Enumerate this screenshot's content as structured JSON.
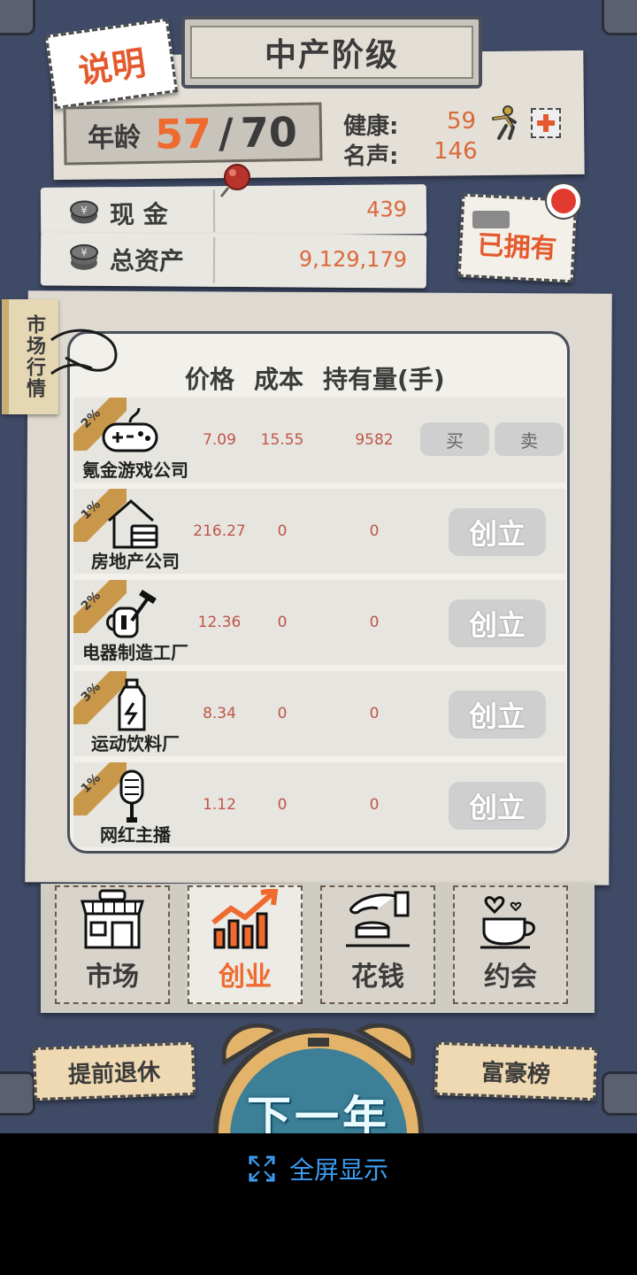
{
  "header": {
    "help_label": "说明",
    "class_title": "中产阶级",
    "age_label": "年龄",
    "age_current": "57",
    "age_separator": "/",
    "age_max": "70",
    "health_label": "健康:",
    "health_value": "59",
    "fame_label": "名声:",
    "fame_value": "146"
  },
  "finance": {
    "cash_label": "现  金",
    "cash_value": "439",
    "assets_label": "总资产",
    "assets_value": "9,129,179",
    "owned_label": "已拥有"
  },
  "market": {
    "side_tag": "市场行情",
    "columns": [
      "价格",
      "成本",
      "持有量(手)"
    ],
    "rows": [
      {
        "name": "氪金游戏公司",
        "badge": "2%",
        "price": "7.09",
        "cost": "15.55",
        "holding": "9582",
        "buy_label": "买",
        "sell_label": "卖",
        "icon": "gamepad-icon"
      },
      {
        "name": "房地产公司",
        "badge": "1%",
        "price": "216.27",
        "cost": "0",
        "holding": "0",
        "found_label": "创立",
        "icon": "house-icon"
      },
      {
        "name": "电器制造工厂",
        "badge": "2%",
        "price": "12.36",
        "cost": "0",
        "holding": "0",
        "found_label": "创立",
        "icon": "kettle-hammer-icon"
      },
      {
        "name": "运动饮料厂",
        "badge": "3%",
        "price": "8.34",
        "cost": "0",
        "holding": "0",
        "found_label": "创立",
        "icon": "bottle-icon"
      },
      {
        "name": "网红主播",
        "badge": "1%",
        "price": "1.12",
        "cost": "0",
        "holding": "0",
        "found_label": "创立",
        "icon": "microphone-icon"
      }
    ]
  },
  "tabs": [
    {
      "label": "市场",
      "icon": "shop-icon",
      "active": false
    },
    {
      "label": "创业",
      "icon": "chart-up-icon",
      "active": true
    },
    {
      "label": "花钱",
      "icon": "coin-hand-icon",
      "active": false
    },
    {
      "label": "约会",
      "icon": "coffee-heart-icon",
      "active": false
    }
  ],
  "footer": {
    "retire_label": "提前退休",
    "rich_list_label": "富豪榜",
    "next_year_label": "下一年",
    "fullscreen_label": "全屏显示"
  },
  "colors": {
    "accent_orange": "#ef6a2f",
    "value_red": "#c0554a",
    "background_navy": "#3f4a66",
    "link_blue": "#3d9df2"
  }
}
